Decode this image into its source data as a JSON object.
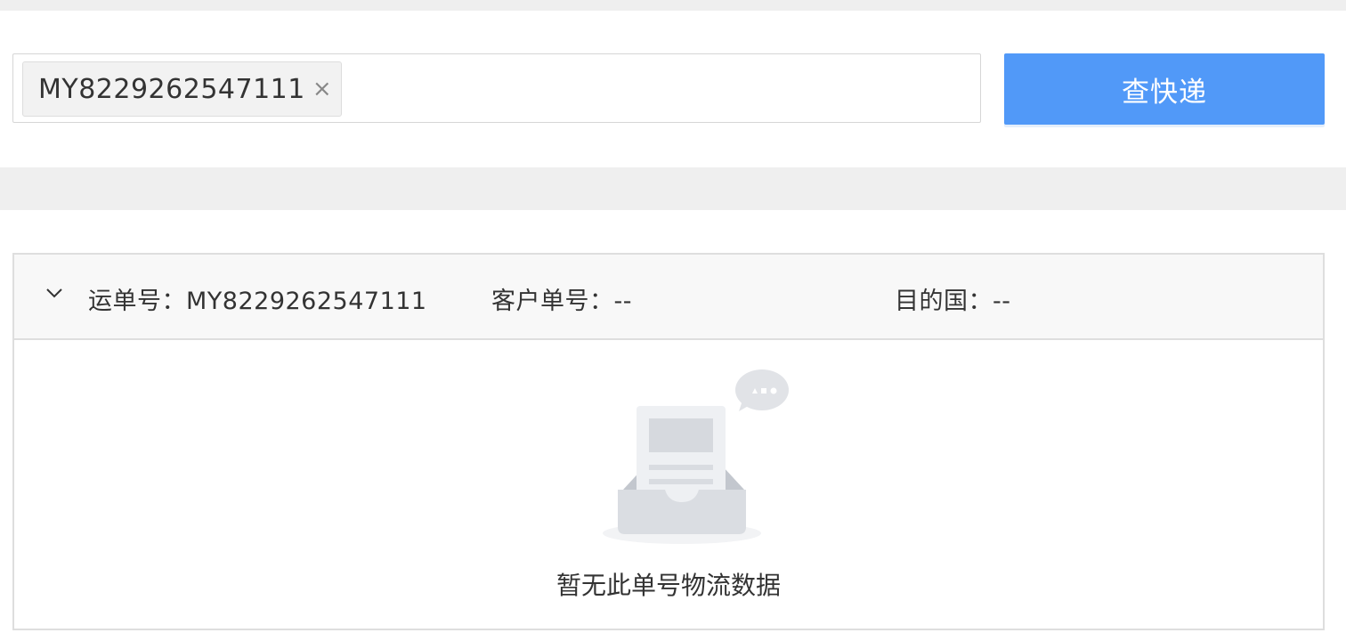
{
  "search": {
    "tag_value": "MY8229262547111",
    "tag_remove_symbol": "×",
    "button_label": "查快递"
  },
  "result": {
    "waybill_label": "运单号：MY8229262547111",
    "customer_no_label": "客户单号：--",
    "destination_label": "目的国：--",
    "empty_message": "暂无此单号物流数据"
  },
  "colors": {
    "primary_button": "#5199f8",
    "band": "#efefef",
    "header_bg": "#f8f8f8"
  },
  "icons": {
    "collapse": "chevron-down-icon",
    "empty": "empty-inbox-icon"
  }
}
